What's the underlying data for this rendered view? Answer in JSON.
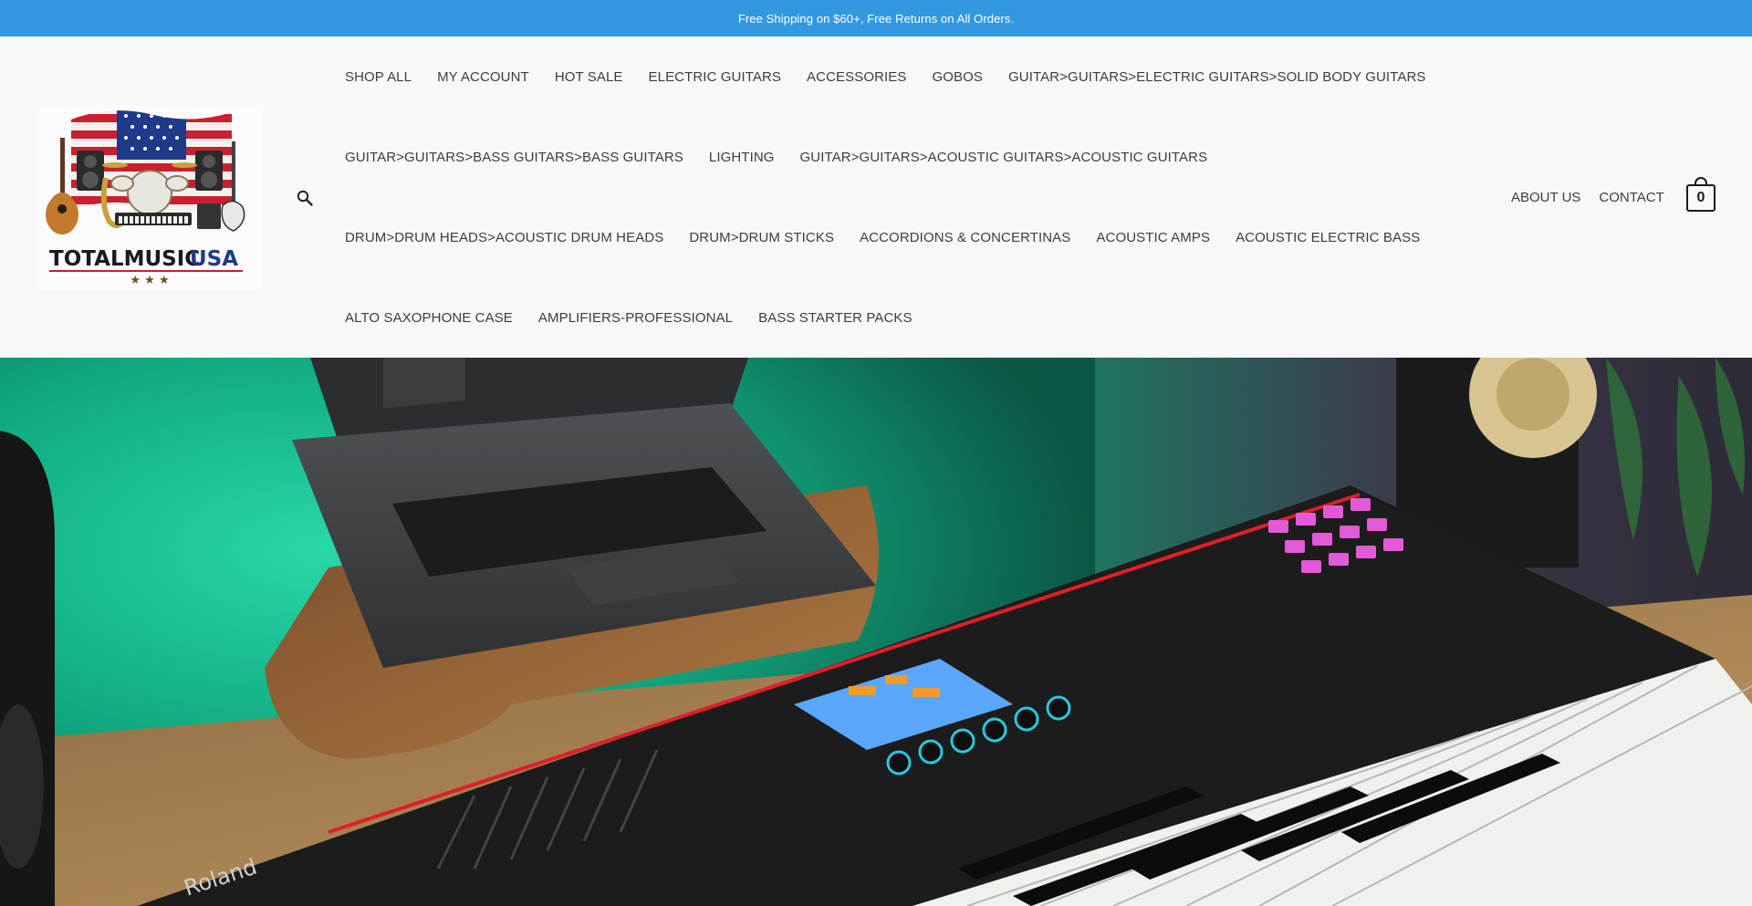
{
  "announcement": {
    "text": "Free Shipping on $60+, Free Returns on All Orders."
  },
  "logo": {
    "text_total": "TOTALMUSIC",
    "text_usa": "USA",
    "stars": "★ ★ ★",
    "colors": {
      "red": "#c8202f",
      "blue": "#1f3a8a",
      "dark": "#1a1a1a"
    }
  },
  "search": {
    "icon": "search-icon"
  },
  "nav": {
    "rows": [
      [
        "SHOP ALL",
        "MY ACCOUNT",
        "HOT SALE",
        "ELECTRIC GUITARS",
        "ACCESSORIES",
        "GOBOS",
        "GUITAR>GUITARS>ELECTRIC GUITARS>SOLID BODY GUITARS"
      ],
      [
        "GUITAR>GUITARS>BASS GUITARS>BASS GUITARS",
        "LIGHTING",
        "GUITAR>GUITARS>ACOUSTIC GUITARS>ACOUSTIC GUITARS"
      ],
      [
        "DRUM>DRUM HEADS>ACOUSTIC DRUM HEADS",
        "DRUM>DRUM STICKS",
        "ACCORDIONS & CONCERTINAS",
        "ACOUSTIC AMPS",
        "ACOUSTIC ELECTRIC BASS"
      ],
      [
        "ALTO SAXOPHONE CASE",
        "AMPLIFIERS-PROFESSIONAL",
        "BASS STARTER PACKS"
      ]
    ]
  },
  "header_links": {
    "about": "ABOUT US",
    "contact": "CONTACT"
  },
  "cart": {
    "count": "0",
    "icon": "shopping-bag-icon"
  },
  "hero": {
    "keyboard_brand": "Roland",
    "colors": {
      "background_green": "#19c79a",
      "desk_wood": "#b98a52",
      "keyboard": "#1c1c1c",
      "pad_pink": "#e25ad8",
      "accent_red": "#e01e2a"
    }
  },
  "theme": {
    "accent": "#3299e0",
    "header_bg": "#f8f8f8",
    "text": "#3d3d3d"
  }
}
